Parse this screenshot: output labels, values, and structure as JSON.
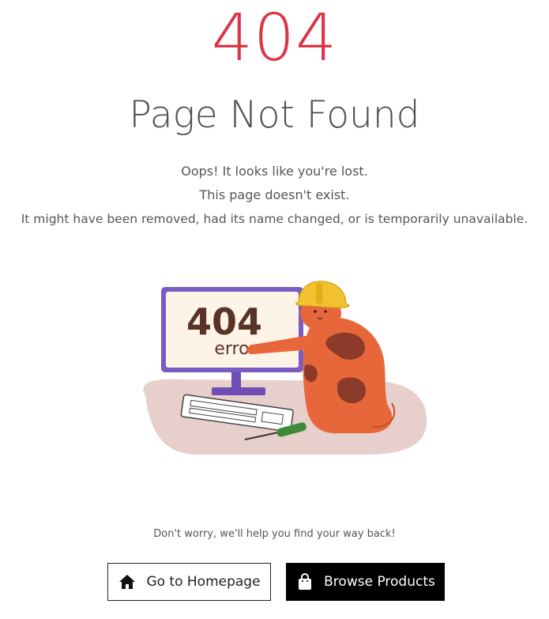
{
  "error": {
    "code": "404",
    "title": "Page Not Found",
    "messages": [
      "Oops! It looks like you're lost.",
      "This page doesn't exist.",
      "It might have been removed, had its name changed, or is temporarily unavailable."
    ]
  },
  "illustration": {
    "screen_code": "404",
    "screen_word": "error"
  },
  "help_text": "Don't worry, we'll help you find your way back!",
  "actions": {
    "home_label": "Go to Homepage",
    "home_icon": "home-icon",
    "browse_label": "Browse Products",
    "browse_icon": "shopping-bag-icon"
  },
  "colors": {
    "accent": "#dc3545",
    "primary_button_bg": "#000000",
    "secondary_button_border": "#222222"
  }
}
